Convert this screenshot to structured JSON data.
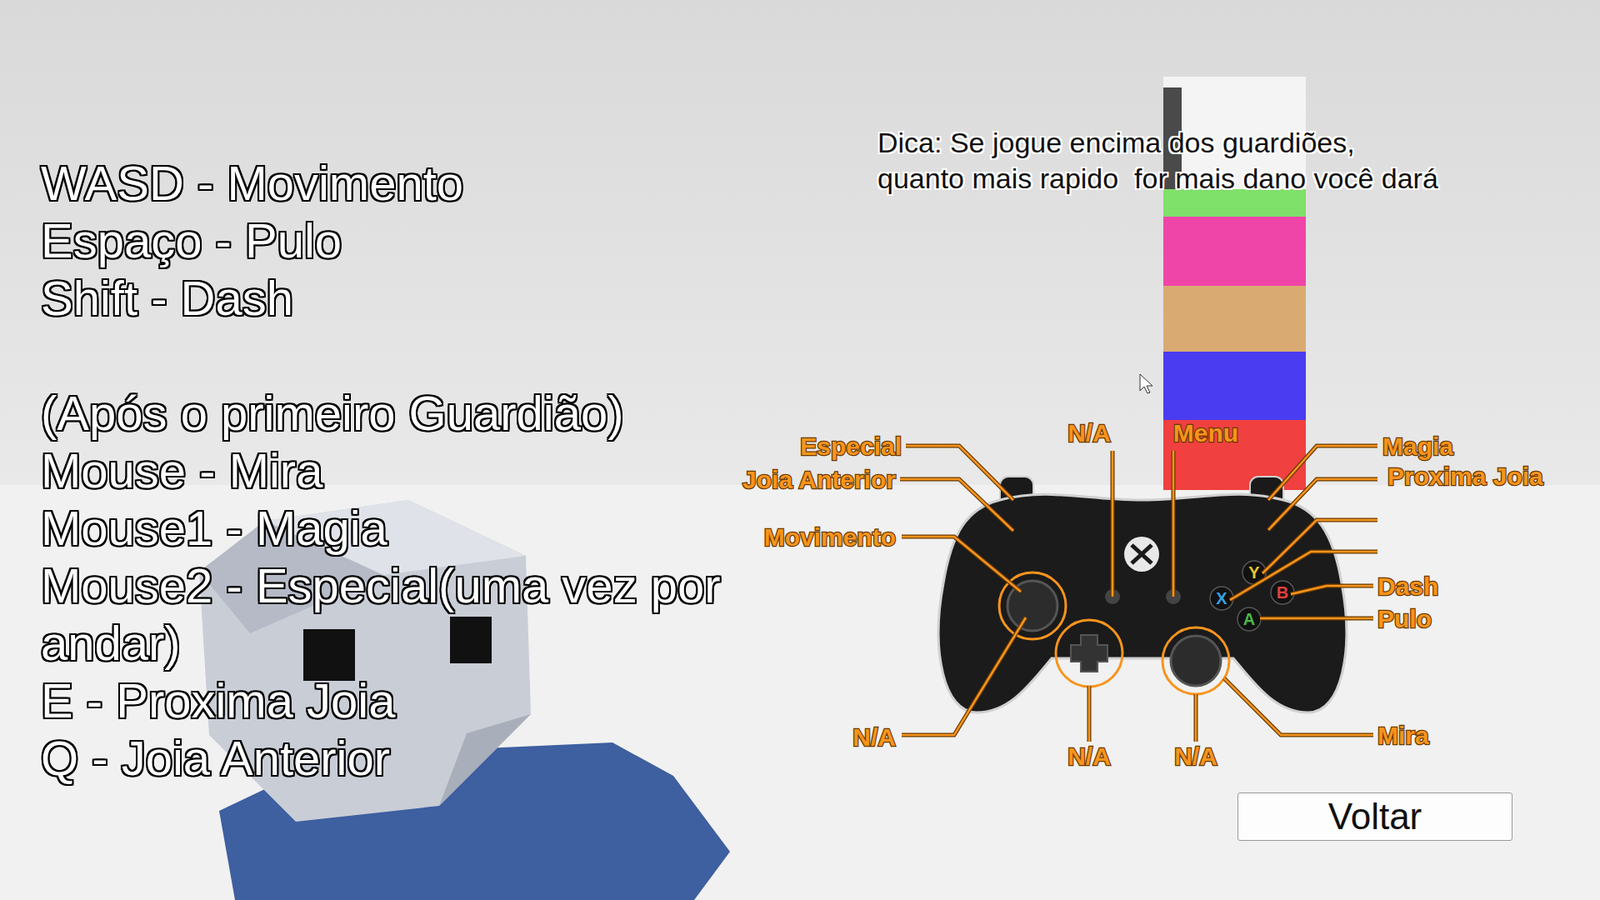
{
  "tip": "Dica: Se jogue encima dos guardiões, quanto mais rapido  for mais dano você dará",
  "keyboard": {
    "basic": [
      "WASD - Movimento",
      "Espaço - Pulo",
      "Shift - Dash"
    ],
    "section_title": "(Após o primeiro Guardião)",
    "advanced": [
      "Mouse - Mira",
      "Mouse1 - Magia",
      "Mouse2 - Especial(uma vez por andar)",
      "E - Proxima Joia",
      "Q - Joia Anterior"
    ]
  },
  "controller": {
    "labels": [
      {
        "text": "Especial"
      },
      {
        "text": "Joia Anterior"
      },
      {
        "text": "Movimento"
      },
      {
        "text": "N/A"
      },
      {
        "text": "Menu"
      },
      {
        "text": "Magia"
      },
      {
        "text": "Proxima Joia"
      },
      {
        "text": "Dash"
      },
      {
        "text": "Pulo"
      },
      {
        "text": "N/A"
      },
      {
        "text": "N/A"
      },
      {
        "text": "N/A"
      },
      {
        "text": "Mira"
      }
    ],
    "face_buttons": [
      {
        "label": "Y",
        "color": "#e8c630"
      },
      {
        "label": "X",
        "color": "#3aa0e0"
      },
      {
        "label": "B",
        "color": "#e0403a"
      },
      {
        "label": "A",
        "color": "#4cb848"
      }
    ]
  },
  "buttons": [
    "Voltar"
  ]
}
